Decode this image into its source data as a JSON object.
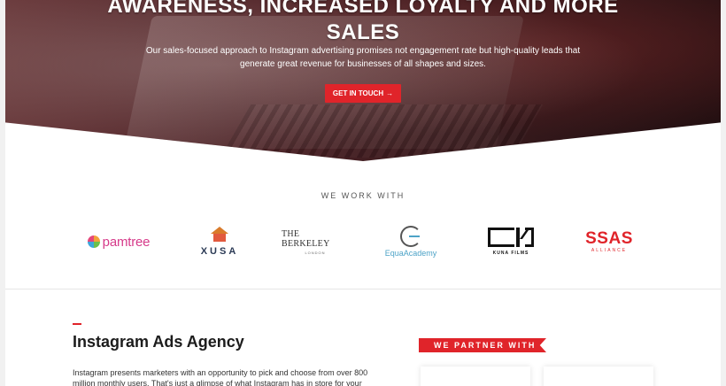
{
  "hero": {
    "title_line1": "AWARENESS, INCREASED LOYALTY AND MORE",
    "title_line2": "SALES",
    "subtitle": "Our sales-focused approach to Instagram advertising promises not engagement rate but high-quality leads that generate great revenue for businesses of all shapes and sizes.",
    "cta_label": "GET IN TOUCH",
    "cta_arrow": "→"
  },
  "work_with": {
    "heading": "WE WORK WITH",
    "logos": {
      "pamtree": "pamtree",
      "xusa": "XUSA",
      "berkeley": "THE BERKELEY",
      "berkeley_sub": "LONDON",
      "equa": "EquaAcademy",
      "kuna": "KUNA FILMS",
      "ssas": "SSAS",
      "ssas_sub": "ALLIANCE"
    }
  },
  "agency": {
    "title": "Instagram Ads Agency",
    "body": "Instagram presents marketers with an opportunity to pick and choose from over 800 million monthly users. That's just a glimpse of what Instagram has in store for your"
  },
  "partner": {
    "ribbon_label": "WE PARTNER WITH"
  },
  "colors": {
    "accent": "#e0242a",
    "hero_dark": "#3a1b1e"
  }
}
